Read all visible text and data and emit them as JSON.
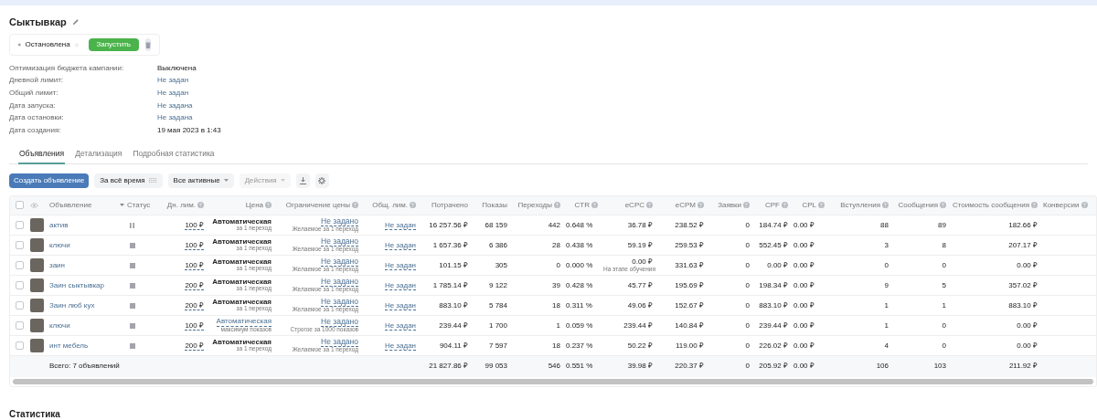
{
  "campaign": {
    "title": "Сыктывкар",
    "running": false,
    "status_label": "Остановлена",
    "start_button": "Запустить"
  },
  "info": [
    {
      "label": "Оптимизация бюджета кампании:",
      "value": "Выключена",
      "kind": "text"
    },
    {
      "label": "Дневной лимит:",
      "value": "Не задан",
      "kind": "link"
    },
    {
      "label": "Общий лимит:",
      "value": "Не задан",
      "kind": "link"
    },
    {
      "label": "Дата запуска:",
      "value": "Не задана",
      "kind": "link"
    },
    {
      "label": "Дата остановки:",
      "value": "Не задана",
      "kind": "link"
    },
    {
      "label": "Дата создания:",
      "value": "19 мая 2023 в 1:43",
      "kind": "text"
    }
  ],
  "tabs": [
    {
      "label": "Объявления",
      "selected": true
    },
    {
      "label": "Детализация",
      "selected": false
    },
    {
      "label": "Подробная статистика",
      "selected": false
    }
  ],
  "toolbar": {
    "create_button": "Создать объявление",
    "period": "За всё время",
    "filter": "Все активные",
    "actions": "Действия",
    "actions_disabled": true
  },
  "table": {
    "select_all_checked": false,
    "columns": [
      {
        "label": "Объявление",
        "help": false,
        "sorted": false
      },
      {
        "label": "Статус",
        "help": false,
        "sorted": true
      },
      {
        "label": "Дн. лим.",
        "help": true,
        "sorted": false
      },
      {
        "label": "Цена",
        "help": true,
        "sorted": false
      },
      {
        "label": "Ограничение цены",
        "help": true,
        "sorted": false
      },
      {
        "label": "Общ. лим.",
        "help": true,
        "sorted": false
      },
      {
        "label": "Потрачено",
        "help": false,
        "sorted": false
      },
      {
        "label": "Показы",
        "help": false,
        "sorted": false
      },
      {
        "label": "Переходы",
        "help": true,
        "sorted": false
      },
      {
        "label": "CTR",
        "help": true,
        "sorted": false
      },
      {
        "label": "eCPC",
        "help": true,
        "sorted": false
      },
      {
        "label": "eCPM",
        "help": true,
        "sorted": false
      },
      {
        "label": "Заявки",
        "help": true,
        "sorted": false
      },
      {
        "label": "CPF",
        "help": true,
        "sorted": false
      },
      {
        "label": "CPL",
        "help": true,
        "sorted": false
      },
      {
        "label": "Вступления",
        "help": true,
        "sorted": false
      },
      {
        "label": "Сообщения",
        "help": true,
        "sorted": false
      },
      {
        "label": "Стоимость сообщения",
        "help": true,
        "sorted": false
      },
      {
        "label": "Конверсии",
        "help": true,
        "sorted": false
      }
    ],
    "rows": [
      {
        "checked": false,
        "name": "актив",
        "paused": true,
        "daily_limit": "100 ₽",
        "price": "Автоматическая",
        "price_note": "за 1 переход",
        "price_strategy": false,
        "price_limit": "Не задано",
        "price_limit_note": "Желаемое за 1 переход",
        "total_limit": "Не задан",
        "spent": "16 257.56 ₽",
        "shows": "68 159",
        "clicks": "442",
        "ctr": "0.648 %",
        "ecpc": "36.78 ₽",
        "ecpm": "238.52 ₽",
        "leads": "0",
        "cpf": "184.74 ₽",
        "cpl": "0.00 ₽",
        "joins": "88",
        "messages": "89",
        "message_cost": "182.66 ₽"
      },
      {
        "checked": false,
        "name": "ключи",
        "paused": false,
        "daily_limit": "100 ₽",
        "price": "Автоматическая",
        "price_note": "за 1 переход",
        "price_strategy": false,
        "price_limit": "Не задано",
        "price_limit_note": "Желаемое за 1 переход",
        "total_limit": "Не задан",
        "spent": "1 657.36 ₽",
        "shows": "6 386",
        "clicks": "28",
        "ctr": "0.438 %",
        "ecpc": "59.19 ₽",
        "ecpm": "259.53 ₽",
        "leads": "0",
        "cpf": "552.45 ₽",
        "cpl": "0.00 ₽",
        "joins": "3",
        "messages": "8",
        "message_cost": "207.17 ₽"
      },
      {
        "checked": false,
        "name": "заин",
        "paused": false,
        "daily_limit": "100 ₽",
        "price": "Автоматическая",
        "price_note": "за 1 переход",
        "price_strategy": false,
        "price_limit": "Не задано",
        "price_limit_note": "Желаемое за 1 переход",
        "total_limit": "Не задан",
        "spent": "101.15 ₽",
        "shows": "305",
        "clicks": "0",
        "ctr": "0.000 %",
        "ecpc": "0.00 ₽",
        "ecpc_note": "На этапе обучения",
        "ecpm": "331.63 ₽",
        "leads": "0",
        "cpf": "0.00 ₽",
        "cpl": "0.00 ₽",
        "joins": "0",
        "messages": "0",
        "message_cost": "0.00 ₽"
      },
      {
        "checked": false,
        "name": "Заин сыктывкар",
        "paused": false,
        "daily_limit": "200 ₽",
        "price": "Автоматическая",
        "price_note": "за 1 переход",
        "price_strategy": false,
        "price_limit": "Не задано",
        "price_limit_note": "Желаемое за 1 переход",
        "total_limit": "Не задан",
        "spent": "1 785.14 ₽",
        "shows": "9 122",
        "clicks": "39",
        "ctr": "0.428 %",
        "ecpc": "45.77 ₽",
        "ecpm": "195.69 ₽",
        "leads": "0",
        "cpf": "198.34 ₽",
        "cpl": "0.00 ₽",
        "joins": "9",
        "messages": "5",
        "message_cost": "357.02 ₽"
      },
      {
        "checked": false,
        "name": "Заин люб кух",
        "paused": false,
        "daily_limit": "200 ₽",
        "price": "Автоматическая",
        "price_note": "за 1 переход",
        "price_strategy": false,
        "price_limit": "Не задано",
        "price_limit_note": "Желаемое за 1 переход",
        "total_limit": "Не задан",
        "spent": "883.10 ₽",
        "shows": "5 784",
        "clicks": "18",
        "ctr": "0.311 %",
        "ecpc": "49.06 ₽",
        "ecpm": "152.67 ₽",
        "leads": "0",
        "cpf": "883.10 ₽",
        "cpl": "0.00 ₽",
        "joins": "1",
        "messages": "1",
        "message_cost": "883.10 ₽"
      },
      {
        "checked": false,
        "name": "ключи",
        "paused": false,
        "daily_limit": "100 ₽",
        "price": "Автоматическая",
        "price_note": "максимум показов",
        "price_strategy": true,
        "price_limit": "Не задано",
        "price_limit_note": "Строгое за 1000 показов",
        "total_limit": "Не задан",
        "spent": "239.44 ₽",
        "shows": "1 700",
        "clicks": "1",
        "ctr": "0.059 %",
        "ecpc": "239.44 ₽",
        "ecpm": "140.84 ₽",
        "leads": "0",
        "cpf": "239.44 ₽",
        "cpl": "0.00 ₽",
        "joins": "1",
        "messages": "0",
        "message_cost": "0.00 ₽"
      },
      {
        "checked": false,
        "name": "инт мебель",
        "paused": false,
        "daily_limit": "200 ₽",
        "price": "Автоматическая",
        "price_note": "за 1 переход",
        "price_strategy": false,
        "price_limit": "Не задано",
        "price_limit_note": "Желаемое за 1 переход",
        "total_limit": "Не задан",
        "spent": "904.11 ₽",
        "shows": "7 597",
        "clicks": "18",
        "ctr": "0.237 %",
        "ecpc": "50.22 ₽",
        "ecpm": "119.00 ₽",
        "leads": "0",
        "cpf": "226.02 ₽",
        "cpl": "0.00 ₽",
        "joins": "4",
        "messages": "0",
        "message_cost": "0.00 ₽"
      }
    ],
    "total": {
      "label": "Всего: 7 объявлений",
      "spent": "21 827.86 ₽",
      "shows": "99 053",
      "clicks": "546",
      "ctr": "0.551 %",
      "ecpc": "39.98 ₽",
      "ecpm": "220.37 ₽",
      "leads": "0",
      "cpf": "205.92 ₽",
      "cpl": "0.00 ₽",
      "joins": "106",
      "messages": "103",
      "message_cost": "211.92 ₽"
    }
  },
  "statistics_title": "Статистика"
}
